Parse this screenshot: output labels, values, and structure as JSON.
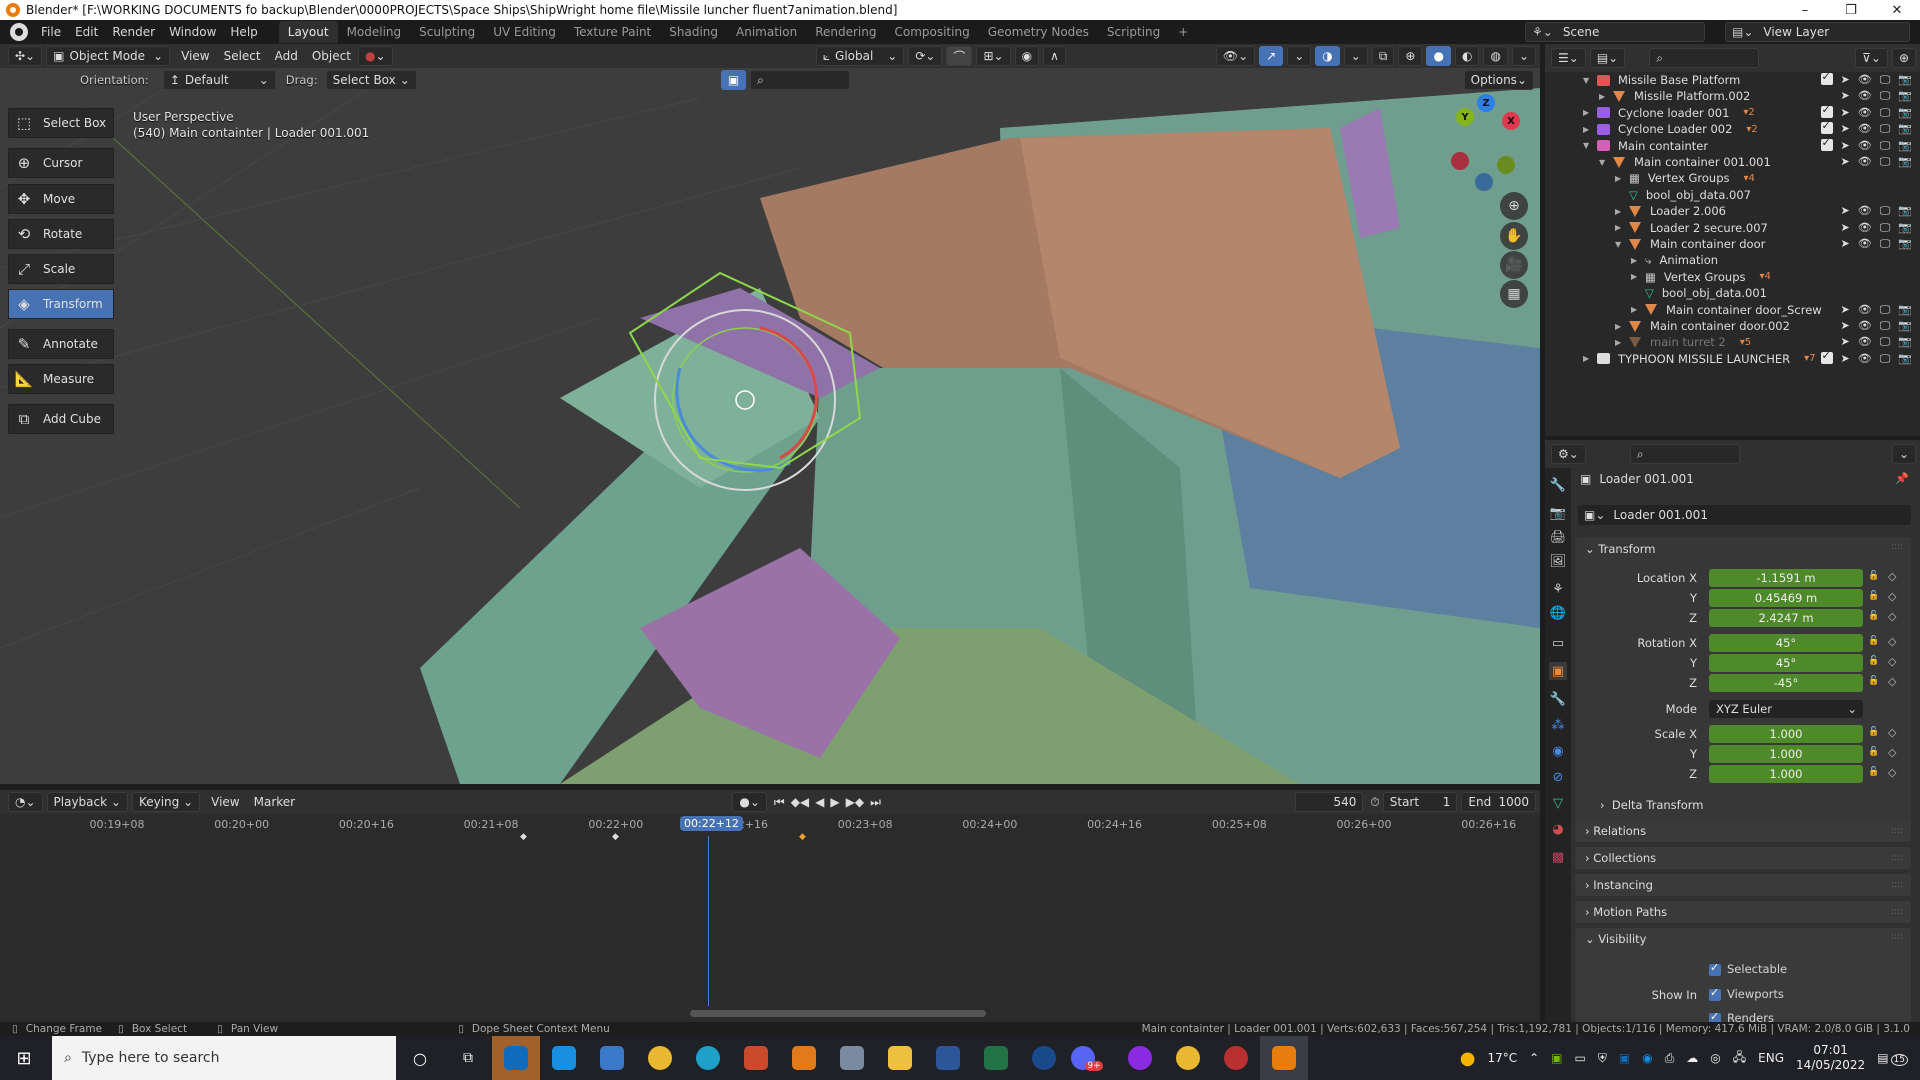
{
  "window": {
    "title": "Blender* [F:\\WORKING DOCUMENTS fo backup\\Blender\\0000PROJECTS\\Space Ships\\ShipWright home file\\Missile luncher fluent7animation.blend]",
    "minimize": "–",
    "maximize": "❐",
    "close": "✕"
  },
  "menubar": {
    "menus": [
      "File",
      "Edit",
      "Render",
      "Window",
      "Help"
    ],
    "workspaces": [
      "Layout",
      "Modeling",
      "Sculpting",
      "UV Editing",
      "Texture Paint",
      "Shading",
      "Animation",
      "Rendering",
      "Compositing",
      "Geometry Nodes",
      "Scripting"
    ],
    "active_workspace": "Layout",
    "add_workspace": "+",
    "scene": "Scene",
    "view_layer": "View Layer"
  },
  "viewport_header": {
    "mode": "Object Mode",
    "menus": [
      "View",
      "Select",
      "Add",
      "Object"
    ],
    "transform_orientation": "Global",
    "orientation_label": "Orientation:",
    "orientation_value": "Default",
    "drag_label": "Drag:",
    "drag_value": "Select Box",
    "options": "Options"
  },
  "viewport": {
    "view_name": "User Perspective",
    "object_info": "(540) Main containter | Loader 001.001",
    "gizmo_axes": [
      "X",
      "Y",
      "Z"
    ]
  },
  "toolbar": {
    "tools": [
      {
        "label": "Select Box",
        "icon": "select-box-icon",
        "active": false
      },
      {
        "label": "Cursor",
        "icon": "cursor-icon",
        "active": false
      },
      {
        "label": "Move",
        "icon": "move-icon",
        "active": false
      },
      {
        "label": "Rotate",
        "icon": "rotate-icon",
        "active": false
      },
      {
        "label": "Scale",
        "icon": "scale-icon",
        "active": false
      },
      {
        "label": "Transform",
        "icon": "transform-icon",
        "active": true
      },
      {
        "label": "Annotate",
        "icon": "annotate-icon",
        "active": false
      },
      {
        "label": "Measure",
        "icon": "measure-icon",
        "active": false
      },
      {
        "label": "Add Cube",
        "icon": "add-cube-icon",
        "active": false
      }
    ]
  },
  "outliner": {
    "items": [
      {
        "label": "Missile Base Platform",
        "type": "collection",
        "color": "#e05555",
        "depth": 0,
        "expanded": true,
        "dim": false,
        "checkbox": true
      },
      {
        "label": "Missile Platform.002",
        "type": "mesh",
        "depth": 1,
        "expanded": false,
        "dim": false,
        "badge": ""
      },
      {
        "label": "Cyclone loader 001",
        "type": "collection",
        "color": "#9a5ee0",
        "depth": 0,
        "expanded": false,
        "dim": false,
        "checkbox": true,
        "badge": "2"
      },
      {
        "label": "Cyclone Loader 002",
        "type": "collection",
        "color": "#9a5ee0",
        "depth": 0,
        "expanded": false,
        "dim": false,
        "checkbox": true,
        "badge": "2"
      },
      {
        "label": "Main containter",
        "type": "collection",
        "color": "#d45fb6",
        "depth": 0,
        "expanded": true,
        "dim": false,
        "checkbox": true
      },
      {
        "label": "Main container 001.001",
        "type": "mesh",
        "depth": 1,
        "expanded": true,
        "dim": false
      },
      {
        "label": "Vertex Groups",
        "type": "vgroup",
        "depth": 2,
        "expanded": false,
        "dim": false,
        "badge": "4"
      },
      {
        "label": "bool_obj_data.007",
        "type": "meshdata",
        "depth": 2,
        "dim": false
      },
      {
        "label": "Loader 2.006",
        "type": "mesh",
        "depth": 2,
        "expanded": false,
        "dim": false
      },
      {
        "label": "Loader 2 secure.007",
        "type": "mesh",
        "depth": 2,
        "expanded": false,
        "dim": false
      },
      {
        "label": "Main container door",
        "type": "mesh",
        "depth": 2,
        "expanded": true,
        "dim": false
      },
      {
        "label": "Animation",
        "type": "anim",
        "depth": 3,
        "expanded": false,
        "dim": false
      },
      {
        "label": "Vertex Groups",
        "type": "vgroup",
        "depth": 3,
        "expanded": false,
        "dim": false,
        "badge": "4"
      },
      {
        "label": "bool_obj_data.001",
        "type": "meshdata",
        "depth": 3,
        "dim": false
      },
      {
        "label": "Main container door_Screw",
        "type": "mesh",
        "depth": 3,
        "expanded": false,
        "dim": false
      },
      {
        "label": "Main container door.002",
        "type": "mesh",
        "depth": 2,
        "expanded": false,
        "dim": false
      },
      {
        "label": "main turret 2",
        "type": "mesh",
        "depth": 2,
        "expanded": false,
        "dim": true,
        "badge": "5"
      },
      {
        "label": "TYPHOON MISSILE LAUNCHER",
        "type": "collection",
        "color": "#dddddd",
        "depth": 0,
        "expanded": false,
        "dim": false,
        "checkbox": true,
        "badge": "7"
      }
    ]
  },
  "properties": {
    "object_name": "Loader 001.001",
    "datablock_name": "Loader 001.001",
    "transform": {
      "title": "Transform",
      "location_label": "Location X",
      "location": [
        "-1.1591 m",
        "0.45469 m",
        "2.4247 m"
      ],
      "rotation_label": "Rotation X",
      "rotation": [
        "45°",
        "45°",
        "-45°"
      ],
      "mode_label": "Mode",
      "mode": "XYZ Euler",
      "scale_label": "Scale X",
      "scale": [
        "1.000",
        "1.000",
        "1.000"
      ],
      "axis_y": "Y",
      "axis_z": "Z",
      "delta": "Delta Transform"
    },
    "panels": [
      "Relations",
      "Collections",
      "Instancing",
      "Motion Paths"
    ],
    "visibility": {
      "title": "Visibility",
      "selectable": "Selectable",
      "show_in": "Show In",
      "viewports": "Viewports",
      "renders": "Renders"
    }
  },
  "timeline": {
    "menus": [
      "Playback",
      "Keying",
      "View",
      "Marker"
    ],
    "current_frame": "540",
    "start_label": "Start",
    "start": "1",
    "end_label": "End",
    "end": "1000",
    "current_time": "00:22+12",
    "ticks": [
      "00:19+08",
      "00:20+00",
      "00:20+16",
      "00:21+08",
      "00:22+00",
      "00:22+16",
      "00:23+08",
      "00:24+00",
      "00:24+16",
      "00:25+08",
      "00:26+00",
      "00:26+16"
    ]
  },
  "statusbar": {
    "hints": [
      "Change Frame",
      "Box Select",
      "Pan View",
      "Dope Sheet Context Menu"
    ],
    "stats": "Main containter | Loader 001.001 | Verts:602,633 | Faces:567,254 | Tris:1,192,781 | Objects:1/116 | Memory: 417.6 MiB | VRAM: 2.0/8.0 GiB | 3.1.0"
  },
  "taskbar": {
    "search_placeholder": "Type here to search",
    "apps": [
      {
        "name": "outlook",
        "color": "#0f6cbd",
        "active": true
      },
      {
        "name": "mail",
        "color": "#1a8fe0"
      },
      {
        "name": "calendar",
        "color": "#3a78c8"
      },
      {
        "name": "chrome",
        "color": "#e9b730"
      },
      {
        "name": "edge",
        "color": "#1fa0c8"
      },
      {
        "name": "thermometer-app",
        "color": "#c84a2a"
      },
      {
        "name": "media-player",
        "color": "#e07a1a"
      },
      {
        "name": "calculator",
        "color": "#7a8aa0"
      },
      {
        "name": "file-explorer",
        "color": "#f0c040"
      },
      {
        "name": "word",
        "color": "#2b579a"
      },
      {
        "name": "excel",
        "color": "#217346"
      },
      {
        "name": "steam",
        "color": "#1b4a8a"
      },
      {
        "name": "discord",
        "color": "#5865f2",
        "badge": "9+"
      },
      {
        "name": "podcast-app",
        "color": "#8a2be2"
      },
      {
        "name": "chrome-2",
        "color": "#e9b730"
      },
      {
        "name": "camera-app",
        "color": "#b83030"
      },
      {
        "name": "blender",
        "color": "#e87d0d",
        "active": true
      }
    ],
    "weather": "17°C",
    "language": "ENG",
    "time": "07:01",
    "date": "14/05/2022",
    "notifications": "15"
  }
}
